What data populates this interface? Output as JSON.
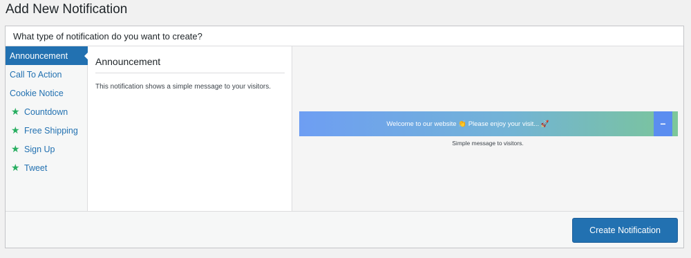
{
  "page": {
    "title": "Add New Notification"
  },
  "panel": {
    "question": "What type of notification do you want to create?"
  },
  "sidebar": {
    "items": [
      {
        "label": "Announcement",
        "active": true,
        "icon": null
      },
      {
        "label": "Call To Action",
        "active": false,
        "icon": null
      },
      {
        "label": "Cookie Notice",
        "active": false,
        "icon": null
      },
      {
        "label": "Countdown",
        "active": false,
        "icon": "star-icon"
      },
      {
        "label": "Free Shipping",
        "active": false,
        "icon": "star-icon"
      },
      {
        "label": "Sign Up",
        "active": false,
        "icon": "star-icon"
      },
      {
        "label": "Tweet",
        "active": false,
        "icon": "star-icon"
      }
    ]
  },
  "detail": {
    "title": "Announcement",
    "description": "This notification shows a simple message to your visitors."
  },
  "preview": {
    "bar_text": "Welcome to our website 👏 Please enjoy your visit... 🚀",
    "collapse_symbol": "−",
    "caption": "Simple message to visitors."
  },
  "footer": {
    "create_label": "Create Notification"
  },
  "colors": {
    "accent": "#2271b1",
    "star": "#27ae60",
    "gradient_start": "#6e9ef3",
    "gradient_end": "#7bc59a"
  }
}
